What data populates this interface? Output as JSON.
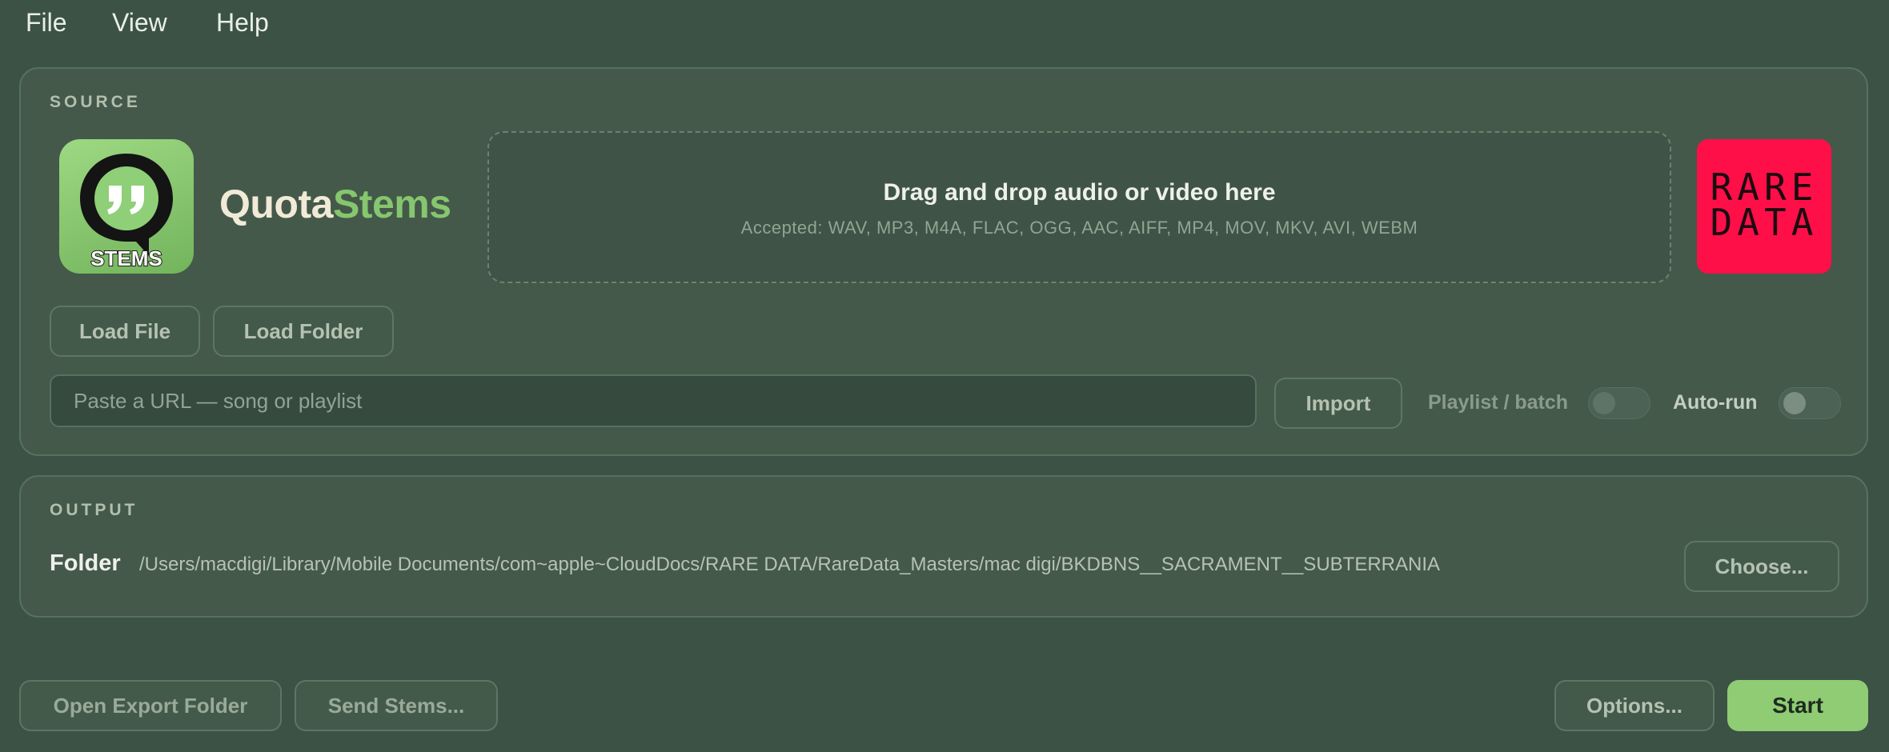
{
  "menu": {
    "file": "File",
    "view": "View",
    "help": "Help"
  },
  "source": {
    "section_label": "SOURCE",
    "brand_part1": "Quota",
    "brand_part2": "Stems",
    "app_icon_text": "STEMS",
    "dropzone_title": "Drag and drop audio or video here",
    "dropzone_accepted": "Accepted: WAV, MP3, M4A, FLAC, OGG, AAC, AIFF, MP4, MOV, MKV, AVI, WEBM",
    "logo_line1": "RARE",
    "logo_line2": "DATA",
    "load_file": "Load File",
    "load_folder": "Load Folder",
    "url_placeholder": "Paste a URL — song or playlist",
    "import": "Import",
    "playlist_label": "Playlist / batch",
    "autorun_label": "Auto-run",
    "playlist_on": false,
    "autorun_on": false
  },
  "output": {
    "section_label": "OUTPUT",
    "folder_label": "Folder",
    "folder_path": "/Users/macdigi/Library/Mobile Documents/com~apple~CloudDocs/RARE DATA/RareData_Masters/mac digi/BKDBNS__SACRAMENT__SUBTERRANIA",
    "choose": "Choose..."
  },
  "footer": {
    "open_export": "Open Export Folder",
    "send_stems": "Send Stems...",
    "options": "Options...",
    "start": "Start"
  },
  "colors": {
    "background": "#3c5244",
    "panel": "#44594a",
    "accent_green": "#8fcc74",
    "brand_red": "#ff0f48"
  }
}
